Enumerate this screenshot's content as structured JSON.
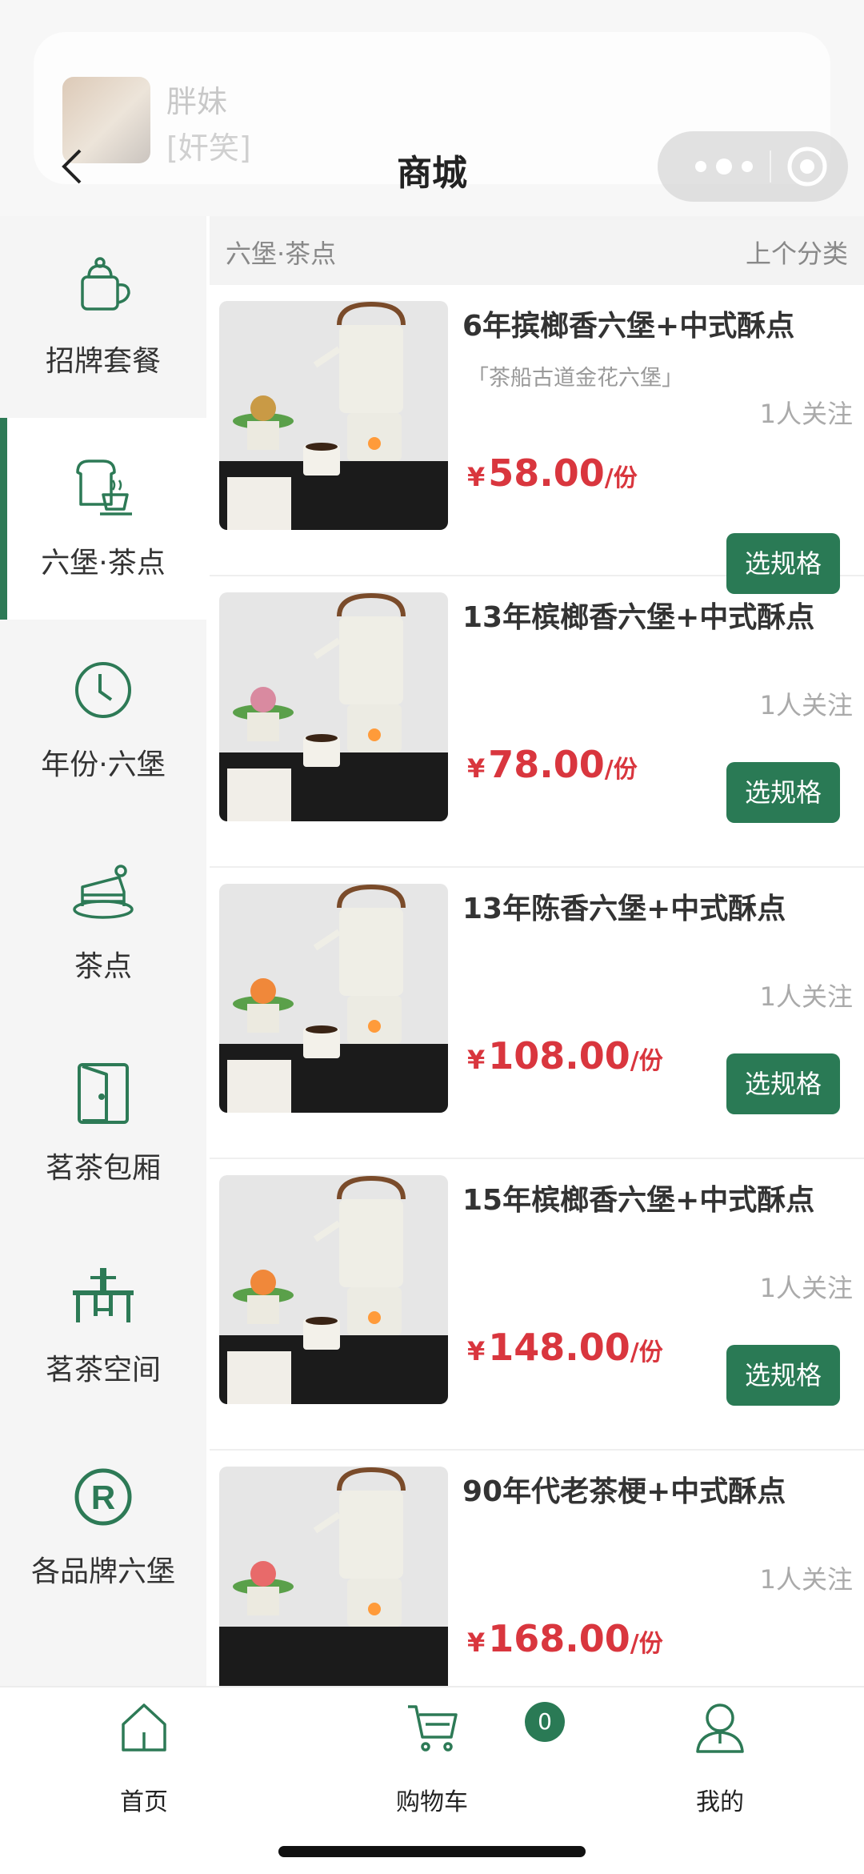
{
  "notification": {
    "name": "胖妹",
    "message": "[奸笑]"
  },
  "header": {
    "title": "商城"
  },
  "sidebar": {
    "items": [
      {
        "label": "招牌套餐",
        "icon": "teapot-icon"
      },
      {
        "label": "六堡·茶点",
        "icon": "toast-tea-icon",
        "active": true
      },
      {
        "label": "年份·六堡",
        "icon": "clock-icon"
      },
      {
        "label": "茶点",
        "icon": "cake-icon"
      },
      {
        "label": "茗茶包厢",
        "icon": "door-icon"
      },
      {
        "label": "茗茶空间",
        "icon": "table-icon"
      },
      {
        "label": "各品牌六堡",
        "icon": "registered-icon"
      }
    ]
  },
  "category_bar": {
    "current": "六堡·茶点",
    "prev": "上个分类"
  },
  "products": [
    {
      "name": "6年摈榔香六堡+中式酥点",
      "subtitle": "「茶船古道金花六堡」",
      "followers": "1人关注",
      "currency": "¥",
      "price": "58.00",
      "unit": "/份",
      "button": "选规格"
    },
    {
      "name": "13年槟榔香六堡+中式酥点",
      "followers": "1人关注",
      "currency": "¥",
      "price": "78.00",
      "unit": "/份",
      "button": "选规格"
    },
    {
      "name": "13年陈香六堡+中式酥点",
      "followers": "1人关注",
      "currency": "¥",
      "price": "108.00",
      "unit": "/份",
      "button": "选规格"
    },
    {
      "name": "15年槟榔香六堡+中式酥点",
      "followers": "1人关注",
      "currency": "¥",
      "price": "148.00",
      "unit": "/份",
      "button": "选规格"
    },
    {
      "name": "90年代老茶梗+中式酥点",
      "followers": "1人关注",
      "currency": "¥",
      "price": "168.00",
      "unit": "/份"
    }
  ],
  "bottom_nav": {
    "home": "首页",
    "cart": "购物车",
    "cart_count": "0",
    "mine": "我的"
  },
  "colors": {
    "accent": "#2a7a55",
    "price": "#d9363e"
  }
}
